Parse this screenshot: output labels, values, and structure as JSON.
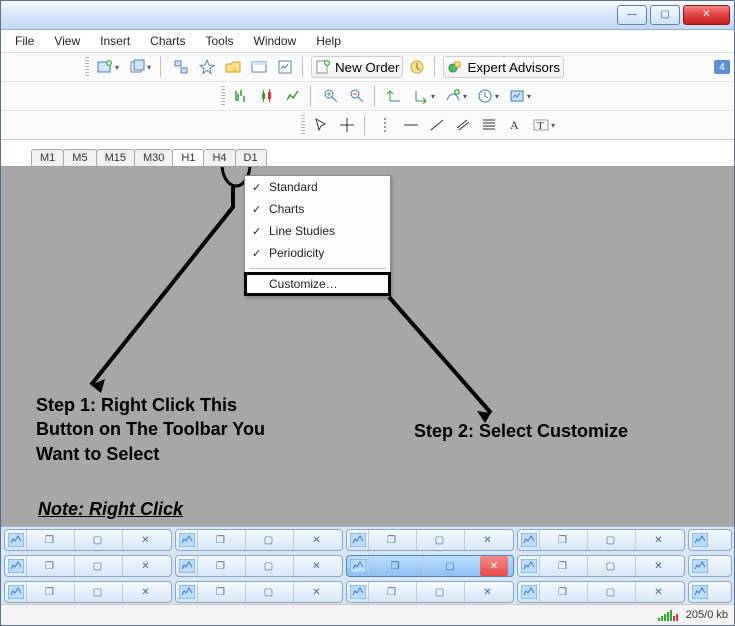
{
  "winbuttons": {
    "min": "—",
    "max": "▢",
    "close": "✕"
  },
  "menubar": [
    "File",
    "View",
    "Insert",
    "Charts",
    "Tools",
    "Window",
    "Help"
  ],
  "toolbar": {
    "new_order": "New Order",
    "expert_advisors": "Expert Advisors",
    "mailbox_count": "4"
  },
  "timeframes": [
    "M1",
    "M5",
    "M15",
    "M30",
    "H1",
    "H4",
    "D1"
  ],
  "active_timeframe": "H1",
  "contextmenu": {
    "items": [
      {
        "label": "Standard",
        "checked": true
      },
      {
        "label": "Charts",
        "checked": true
      },
      {
        "label": "Line Studies",
        "checked": true
      },
      {
        "label": "Periodicity",
        "checked": true
      }
    ],
    "customize": "Customize…"
  },
  "annotations": {
    "step1": "Step 1: Right Click This Button on The Toolbar You Want to Select",
    "step2": "Step 2: Select Customize",
    "note": "Note: Right Click"
  },
  "status": {
    "traffic": "205/0 kb"
  },
  "mdi": {
    "rows": 3,
    "per_row": 4,
    "selected": {
      "row": 1,
      "col": 2
    }
  }
}
